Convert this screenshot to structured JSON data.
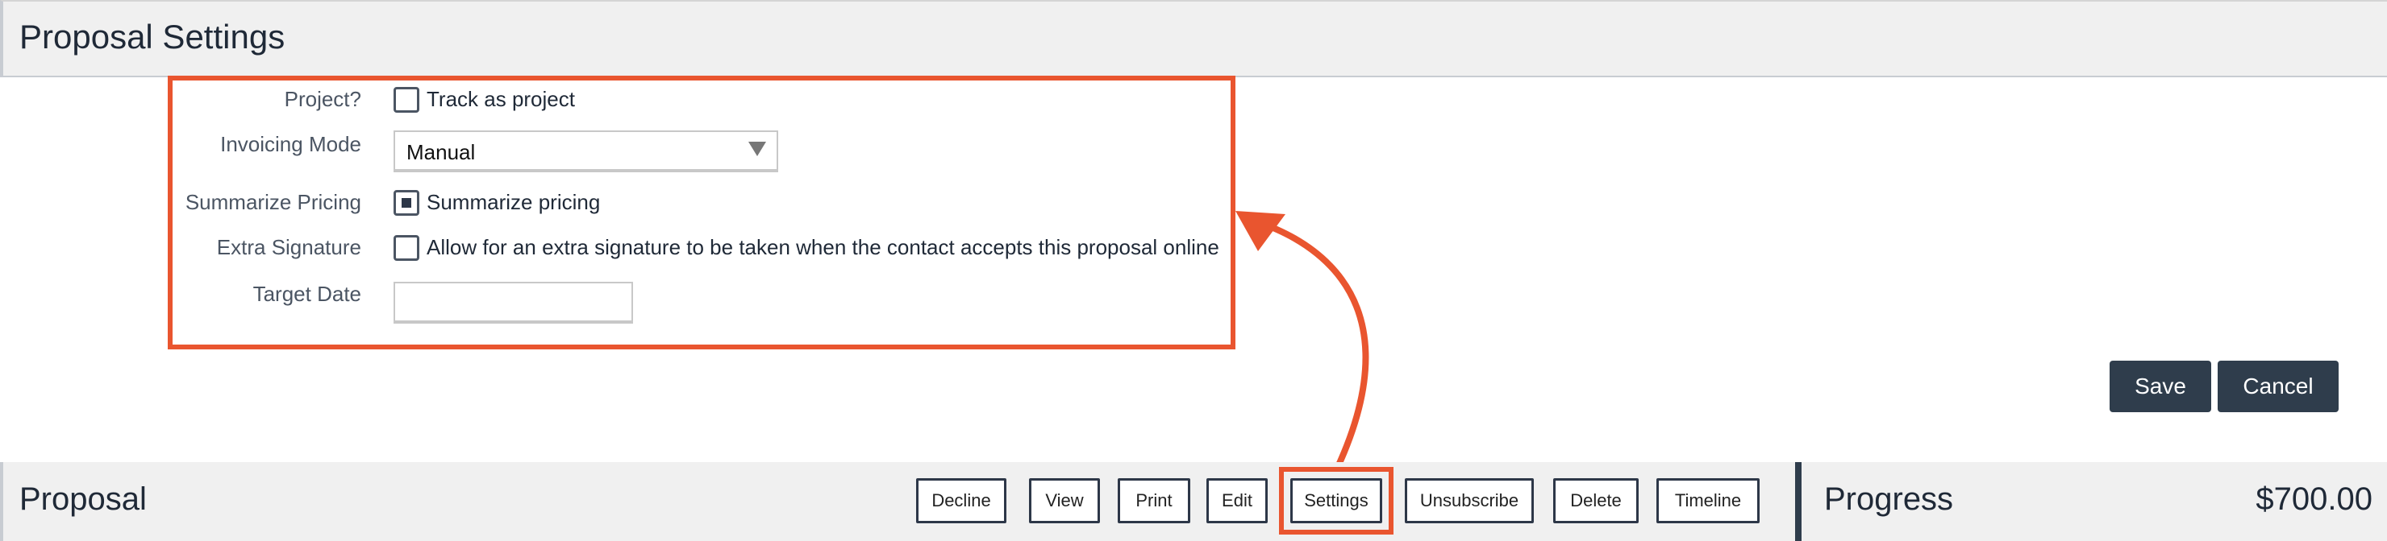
{
  "header": {
    "title": "Proposal Settings"
  },
  "form": {
    "project": {
      "label": "Project?",
      "option": "Track as project",
      "checked": false
    },
    "invoicing": {
      "label": "Invoicing Mode",
      "value": "Manual"
    },
    "summarize": {
      "label": "Summarize Pricing",
      "option": "Summarize pricing",
      "checked": true
    },
    "extra_signature": {
      "label": "Extra Signature",
      "option": "Allow for an extra signature to be taken when the contact accepts this proposal online",
      "checked": false
    },
    "target_date": {
      "label": "Target Date",
      "value": ""
    }
  },
  "actions": {
    "save": "Save",
    "cancel": "Cancel"
  },
  "footer": {
    "title": "Proposal",
    "buttons": [
      "Decline",
      "View",
      "Print",
      "Edit",
      "Settings",
      "Unsubscribe",
      "Delete",
      "Timeline"
    ],
    "progress_title": "Progress",
    "progress_amount": "$700.00"
  },
  "colors": {
    "accent": "#e9552f",
    "dark": "#2f3d4c",
    "header_bg": "#f0f0f0"
  }
}
